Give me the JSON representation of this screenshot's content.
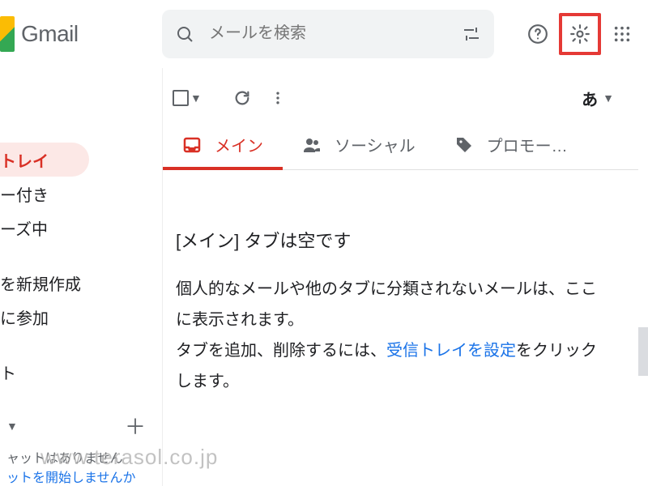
{
  "header": {
    "product": "Gmail",
    "search_placeholder": "メールを検索"
  },
  "sidebar": {
    "items": [
      {
        "label": "トレイ"
      },
      {
        "label": "ー付き"
      },
      {
        "label": "ーズ中"
      }
    ],
    "items2": [
      {
        "label": "を新規作成"
      },
      {
        "label": "に参加"
      }
    ],
    "section3": "ト",
    "chat_empty": "ャットはありません",
    "chat_start": "ットを開始しませんか"
  },
  "toolbar": {
    "lang": "あ"
  },
  "tabs": [
    {
      "label": "メイン"
    },
    {
      "label": "ソーシャル"
    },
    {
      "label": "プロモー…"
    }
  ],
  "empty": {
    "title": "[メイン] タブは空です",
    "p1": "個人的なメールや他のタブに分類されないメールは、ここに表示されます。",
    "p2_a": "タブを追加、削除するには、",
    "p2_link": "受信トレイを設定",
    "p2_b": "をクリックします。"
  },
  "watermark": "www.terasol.co.jp"
}
